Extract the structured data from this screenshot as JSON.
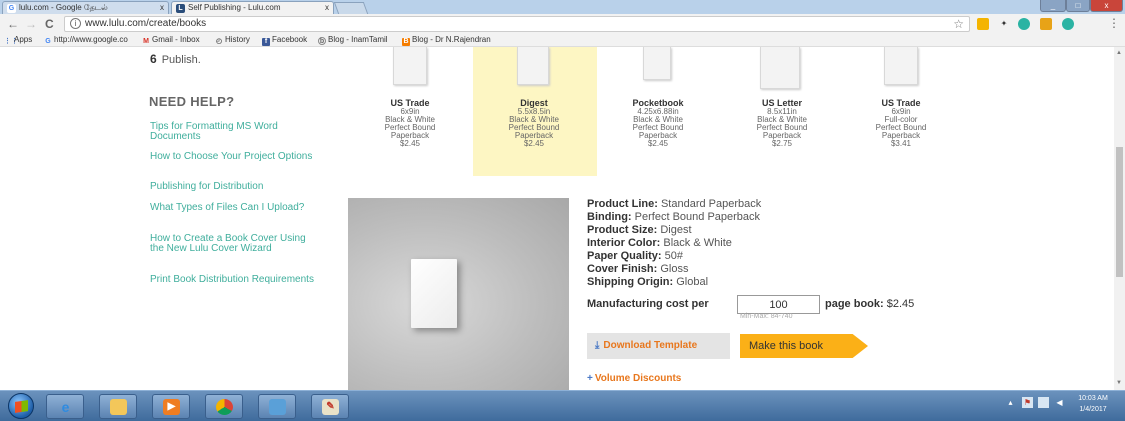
{
  "browser": {
    "tabs": [
      {
        "title": "lulu.com - Google தேடல்",
        "icon": "google-icon",
        "active": false
      },
      {
        "title": "Self Publishing - Lulu.com",
        "icon": "lulu-icon",
        "active": true
      }
    ],
    "tab_close": "x",
    "window_buttons": {
      "minimize": "_",
      "maximize": "□",
      "close": "x"
    },
    "nav": {
      "back": "←",
      "forward": "→",
      "reload": "C"
    },
    "info_symbol": "i",
    "url": "www.lulu.com/create/books",
    "star": "☆",
    "menu": "⋮",
    "bookmarks": [
      {
        "label": "Apps",
        "icon": "apps-grid-icon"
      },
      {
        "label": "http://www.google.co",
        "icon": "google-icon"
      },
      {
        "label": "Gmail - Inbox",
        "icon": "gmail-icon"
      },
      {
        "label": "History",
        "icon": "history-icon"
      },
      {
        "label": "Facebook",
        "icon": "facebook-icon"
      },
      {
        "label": "Blog - InamTamil",
        "icon": "blogger-icon"
      },
      {
        "label": "Blog - Dr N.Rajendran",
        "icon": "blogger-icon"
      }
    ]
  },
  "page": {
    "step": {
      "number": "6",
      "label": "Publish."
    },
    "help_title": "NEED HELP?",
    "help_links": [
      "Tips for Formatting MS Word Documents",
      "How to Choose Your Project Options",
      "Publishing for Distribution",
      "What Types of Files Can I Upload?",
      "How to Create a Book Cover Using the New Lulu Cover Wizard",
      "Print Book Distribution Requirements"
    ],
    "products": [
      {
        "name": "US Trade",
        "size": "6x9in",
        "color": "Black & White",
        "binding": "Perfect Bound",
        "type": "Paperback",
        "price": "$2.45",
        "selected": false
      },
      {
        "name": "Digest",
        "size": "5.5x8.5in",
        "color": "Black & White",
        "binding": "Perfect Bound",
        "type": "Paperback",
        "price": "$2.45",
        "selected": true
      },
      {
        "name": "Pocketbook",
        "size": "4.25x6.88in",
        "color": "Black & White",
        "binding": "Perfect Bound",
        "type": "Paperback",
        "price": "$2.45",
        "selected": false
      },
      {
        "name": "US Letter",
        "size": "8.5x11in",
        "color": "Black & White",
        "binding": "Perfect Bound",
        "type": "Paperback",
        "price": "$2.75",
        "selected": false
      },
      {
        "name": "US Trade",
        "size": "6x9in",
        "color": "Full-color",
        "binding": "Perfect Bound",
        "type": "Paperback",
        "price": "$3.41",
        "selected": false
      }
    ],
    "specs": [
      {
        "label": "Product Line:",
        "value": "Standard Paperback"
      },
      {
        "label": "Binding:",
        "value": "Perfect Bound Paperback"
      },
      {
        "label": "Product Size:",
        "value": "Digest"
      },
      {
        "label": "Interior Color:",
        "value": "Black & White"
      },
      {
        "label": "Paper Quality:",
        "value": "50#"
      },
      {
        "label": "Cover Finish:",
        "value": "Gloss"
      },
      {
        "label": "Shipping Origin:",
        "value": "Global"
      }
    ],
    "cost": {
      "label": "Manufacturing cost per",
      "pages_value": "100",
      "pages_hint": "Min-Max: 84-740",
      "suffix_label": "page book:",
      "price": "$2.45"
    },
    "buttons": {
      "download_icon": "⤓",
      "download": "Download Template",
      "make": "Make this book"
    },
    "volume": {
      "plus": "+",
      "label": "Volume Discounts"
    }
  },
  "taskbar": {
    "apps": [
      "internet-explorer-icon",
      "file-explorer-icon",
      "media-player-icon",
      "chrome-icon",
      "network-icon",
      "paint-icon"
    ],
    "clock_time": "10:03 AM",
    "clock_date": "1/4/2017"
  },
  "colors": {
    "link": "#3fae9c",
    "accent_orange": "#e8771d",
    "make_button": "#fbb017",
    "selected_bg": "#fdf6c3"
  }
}
